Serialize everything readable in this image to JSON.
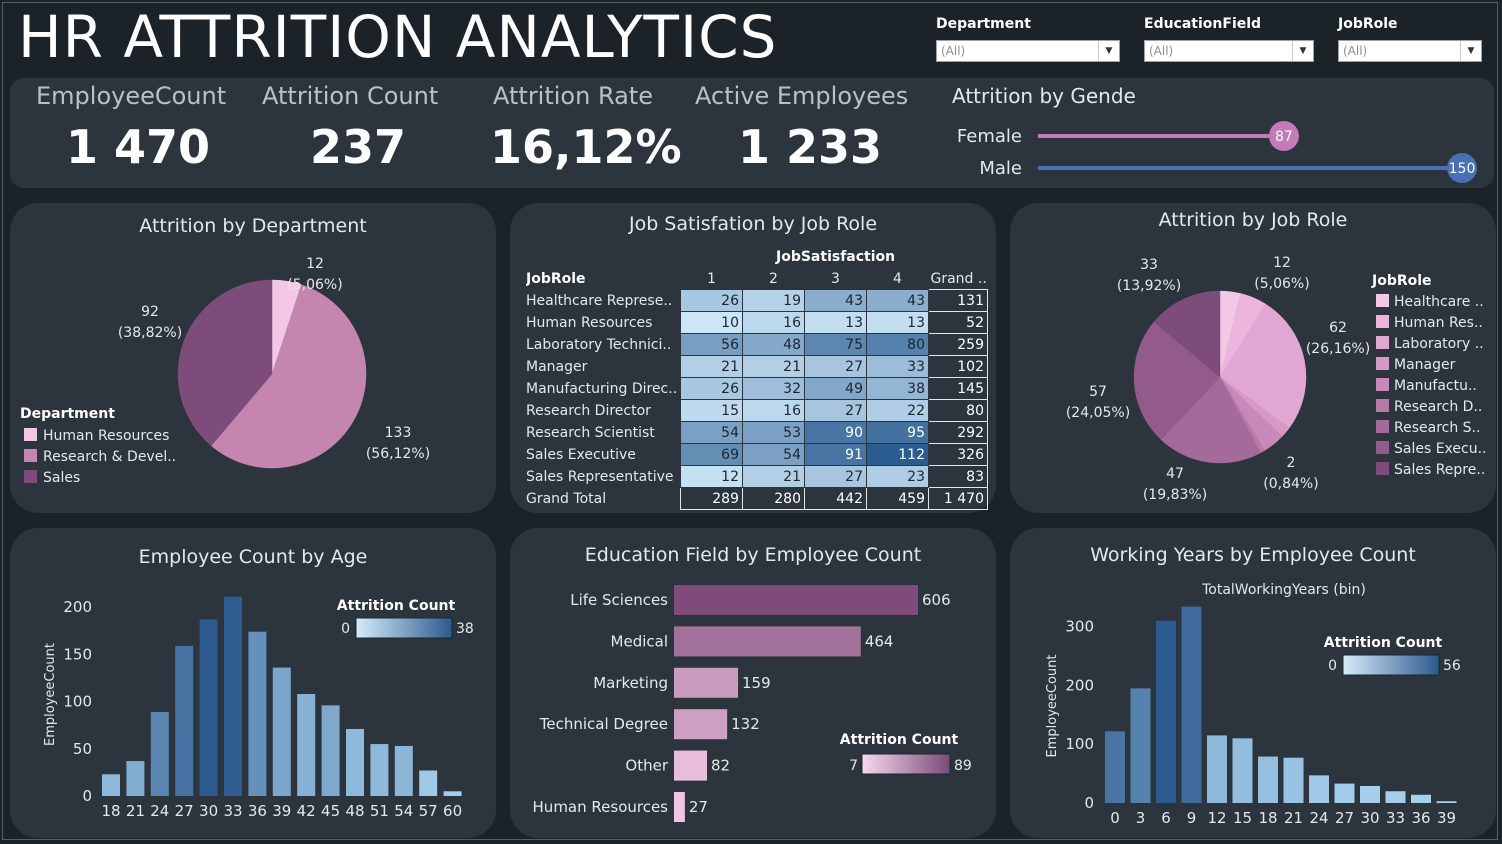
{
  "title": "HR ATTRITION ANALYTICS",
  "filters": [
    {
      "label": "Department",
      "value": "(All)"
    },
    {
      "label": "EducationField",
      "value": "(All)"
    },
    {
      "label": "JobRole",
      "value": "(All)"
    }
  ],
  "kpis": {
    "employee_count": {
      "label": "EmployeeCount",
      "value": "1 470"
    },
    "attrition_count": {
      "label": "Attrition Count",
      "value": "237"
    },
    "attrition_rate": {
      "label": "Attrition Rate",
      "value": "16,12%"
    },
    "active_employees": {
      "label": "Active Employees",
      "value": "1 233"
    }
  },
  "gender": {
    "title": "Attrition by Gende",
    "rows": [
      {
        "label": "Female",
        "value": 87,
        "color": "#c479b8"
      },
      {
        "label": "Male",
        "value": 150,
        "color": "#4a6fb5"
      }
    ]
  },
  "colors": {
    "panel": "#2c353d",
    "background": "#1b2329",
    "blue_dark": "#2f5a8f",
    "blue_light": "#a8d1ec",
    "pink_light": "#f2c8e6",
    "purple_dark": "#7a4a78"
  },
  "chart_data": [
    {
      "id": "dept",
      "type": "pie",
      "title": "Attrition by Department",
      "legend_title": "Department",
      "slices": [
        {
          "name": "Human Resources",
          "legend": "Human Resources",
          "value": 12,
          "pct": "(5,06%)",
          "color": "#f2c8e6"
        },
        {
          "name": "Research & Development",
          "legend": "Research & Devel..",
          "value": 133,
          "pct": "(56,12%)",
          "color": "#c486ae"
        },
        {
          "name": "Sales",
          "legend": "Sales",
          "value": 92,
          "pct": "(38,82%)",
          "color": "#7e4c7a"
        }
      ]
    },
    {
      "id": "jobsat",
      "type": "table",
      "title": "Job Satisfation by Job Role",
      "col_header": "JobSatisfaction",
      "row_header": "JobRole",
      "columns": [
        "1",
        "2",
        "3",
        "4",
        "Grand .."
      ],
      "rows": [
        {
          "label": "Healthcare Represe..",
          "values": [
            26,
            19,
            43,
            43
          ],
          "total": "131"
        },
        {
          "label": "Human Resources",
          "values": [
            10,
            16,
            13,
            13
          ],
          "total": "52"
        },
        {
          "label": "Laboratory Technici..",
          "values": [
            56,
            48,
            75,
            80
          ],
          "total": "259"
        },
        {
          "label": "Manager",
          "values": [
            21,
            21,
            27,
            33
          ],
          "total": "102"
        },
        {
          "label": "Manufacturing Direc..",
          "values": [
            26,
            32,
            49,
            38
          ],
          "total": "145"
        },
        {
          "label": "Research Director",
          "values": [
            15,
            16,
            27,
            22
          ],
          "total": "80"
        },
        {
          "label": "Research Scientist",
          "values": [
            54,
            53,
            90,
            95
          ],
          "total": "292"
        },
        {
          "label": "Sales Executive",
          "values": [
            69,
            54,
            91,
            112
          ],
          "total": "326"
        },
        {
          "label": "Sales Representative",
          "values": [
            12,
            21,
            27,
            23
          ],
          "total": "83"
        }
      ],
      "grand_total": {
        "label": "Grand Total",
        "values": [
          "289",
          "280",
          "442",
          "459"
        ],
        "total": "1 470"
      }
    },
    {
      "id": "jobrole",
      "type": "pie",
      "title": "Attrition by Job Role",
      "legend_title": "JobRole",
      "slices": [
        {
          "name": "Healthcare Representative",
          "legend": "Healthcare ..",
          "value": 9,
          "color": "#f2c8e6"
        },
        {
          "name": "Human Resources",
          "legend": "Human Res..",
          "value": 12,
          "pct": "(5,06%)",
          "color": "#ecb6dc"
        },
        {
          "name": "Laboratory Technician",
          "legend": "Laboratory ..",
          "value": 62,
          "pct": "(26,16%)",
          "color": "#e2a6d2"
        },
        {
          "name": "Manager",
          "legend": "Manager",
          "value": 5,
          "color": "#d898c4"
        },
        {
          "name": "Manufacturing Director",
          "legend": "Manufactu..",
          "value": 10,
          "color": "#c989b8"
        },
        {
          "name": "Research Director",
          "legend": "Research D..",
          "value": 2,
          "pct": "(0,84%)",
          "color": "#b67aa8"
        },
        {
          "name": "Research Scientist",
          "legend": "Research S..",
          "value": 47,
          "pct": "(19,83%)",
          "color": "#a46a99"
        },
        {
          "name": "Sales Executive",
          "legend": "Sales Execu..",
          "value": 57,
          "pct": "(24,05%)",
          "color": "#935b8a"
        },
        {
          "name": "Sales Representative",
          "legend": "Sales Repre..",
          "value": 33,
          "pct": "(13,92%)",
          "color": "#7e4c7a"
        }
      ]
    },
    {
      "id": "age",
      "type": "bar",
      "title": "Employee Count by Age",
      "ylabel": "EmployeeCount",
      "x_ticks": [
        "18",
        "21",
        "24",
        "27",
        "30",
        "33",
        "36",
        "39",
        "42",
        "45",
        "48",
        "51",
        "54",
        "57",
        "60"
      ],
      "y_ticks": [
        0,
        50,
        100,
        150,
        200
      ],
      "ylim": [
        0,
        215
      ],
      "legend_title": "Attrition Count",
      "legend_min": "0",
      "legend_max": "38",
      "values": [
        23,
        37,
        89,
        159,
        187,
        211,
        174,
        136,
        108,
        96,
        71,
        55,
        53,
        27,
        5
      ],
      "attrition": [
        8,
        12,
        24,
        30,
        38,
        37,
        21,
        14,
        10,
        13,
        8,
        8,
        9,
        3,
        2
      ]
    },
    {
      "id": "edu",
      "type": "bar",
      "orientation": "horizontal",
      "title": "Education Field by Employee Count",
      "legend_title": "Attrition Count",
      "legend_min": "7",
      "legend_max": "89",
      "categories": [
        "Life Sciences",
        "Medical",
        "Marketing",
        "Technical Degree",
        "Other",
        "Human Resources"
      ],
      "values": [
        606,
        464,
        159,
        132,
        82,
        27
      ],
      "attrition": [
        89,
        63,
        35,
        32,
        12,
        7
      ]
    },
    {
      "id": "years",
      "type": "bar",
      "title": "Working Years by Employee Count",
      "xlabel": "TotalWorkingYears (bin)",
      "ylabel": "EmployeeCount",
      "x_ticks": [
        "0",
        "3",
        "6",
        "9",
        "12",
        "15",
        "18",
        "21",
        "24",
        "27",
        "30",
        "33",
        "36",
        "39"
      ],
      "y_ticks": [
        0,
        100,
        200,
        300
      ],
      "ylim": [
        0,
        330
      ],
      "legend_title": "Attrition Count",
      "legend_min": "0",
      "legend_max": "56",
      "values": [
        122,
        195,
        310,
        334,
        115,
        110,
        79,
        77,
        47,
        33,
        29,
        20,
        14,
        3
      ],
      "attrition": [
        44,
        38,
        56,
        48,
        12,
        10,
        9,
        7,
        4,
        3,
        2,
        2,
        1,
        0
      ]
    }
  ]
}
